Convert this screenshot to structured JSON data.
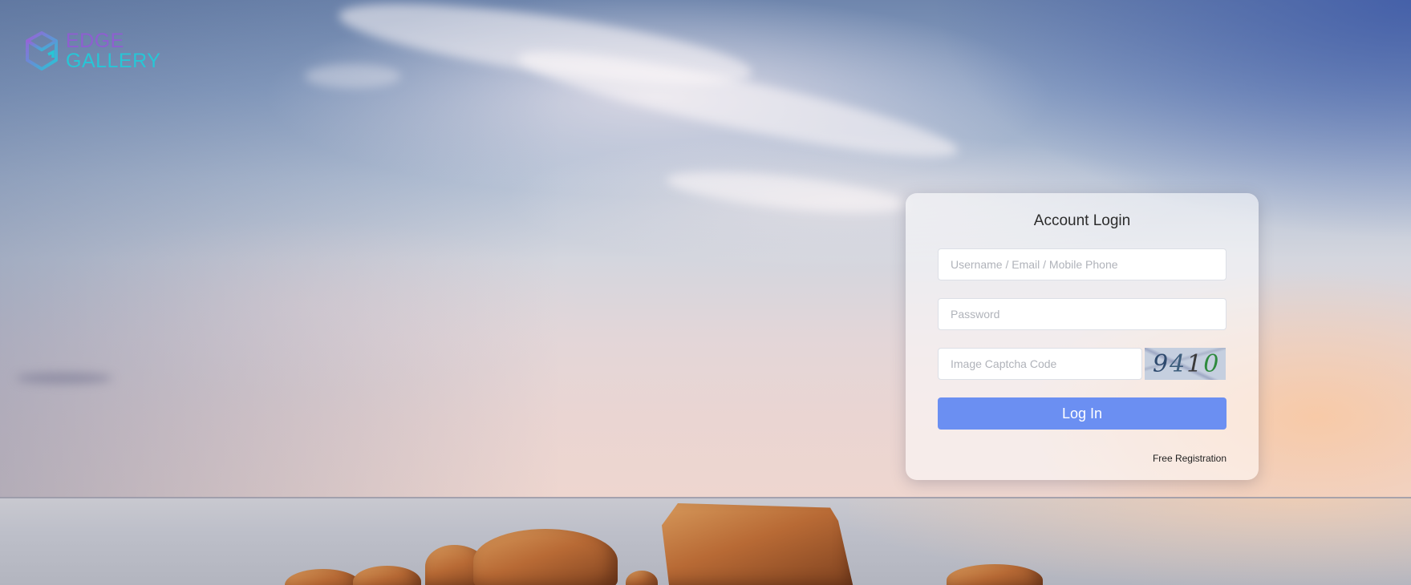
{
  "brand": {
    "line1": "EDGE",
    "line2": "GALLERY",
    "icon": "cube-logo-icon",
    "colors": {
      "line1": "#8e5fd0",
      "line2": "#27c6d6"
    }
  },
  "login": {
    "title": "Account Login",
    "username_placeholder": "Username / Email / Mobile Phone",
    "password_placeholder": "Password",
    "captcha_placeholder": "Image Captcha Code",
    "captcha_digits": [
      "9",
      "4",
      "1",
      "0"
    ],
    "login_button": "Log In",
    "register_link": "Free Registration",
    "colors": {
      "button": "#6b8ff2"
    }
  }
}
